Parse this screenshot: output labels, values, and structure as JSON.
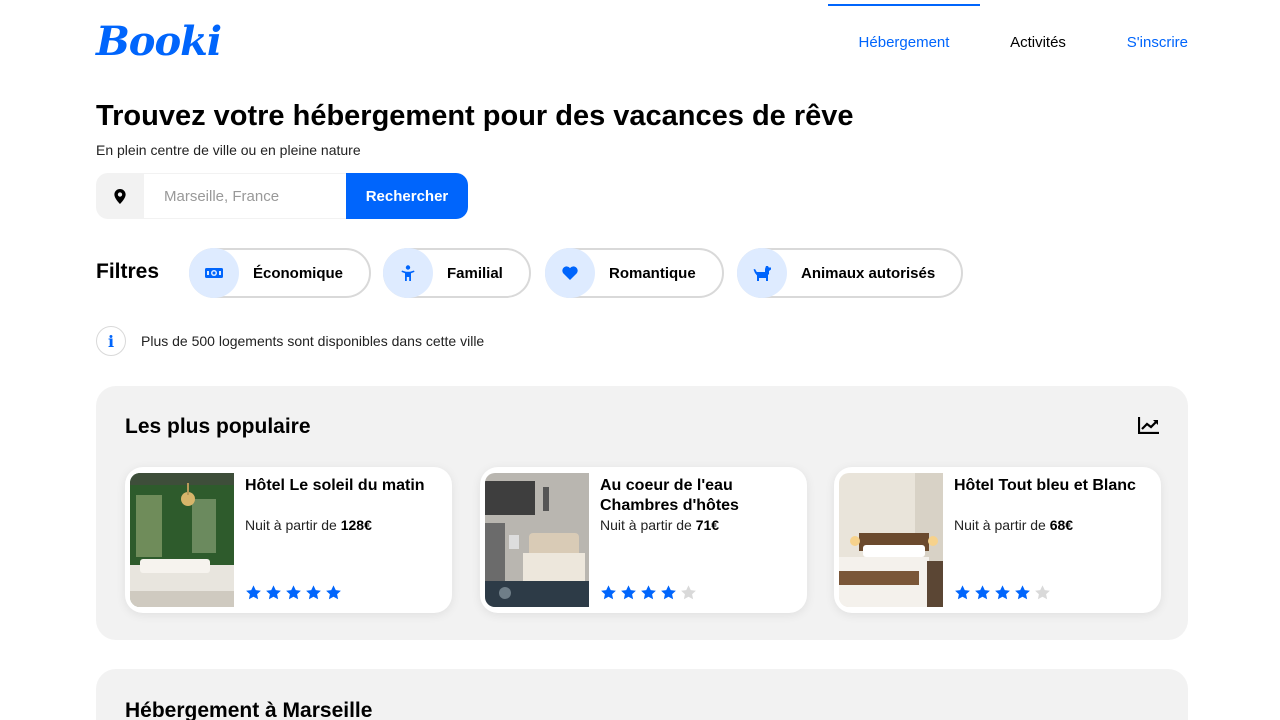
{
  "header": {
    "logo": "Booki",
    "nav": [
      {
        "label": "Hébergement",
        "active": true
      },
      {
        "label": "Activités",
        "active": false
      },
      {
        "label": "S'inscrire",
        "active": false
      }
    ]
  },
  "hero": {
    "title": "Trouvez votre hébergement pour des vacances de rêve",
    "subtitle": "En plein centre de ville ou en pleine nature"
  },
  "search": {
    "icon": "location-pin-icon",
    "placeholder": "Marseille, France",
    "button_label": "Rechercher"
  },
  "filters": {
    "label": "Filtres",
    "items": [
      {
        "label": "Économique",
        "icon": "money-icon"
      },
      {
        "label": "Familial",
        "icon": "child-icon"
      },
      {
        "label": "Romantique",
        "icon": "heart-icon"
      },
      {
        "label": "Animaux autorisés",
        "icon": "dog-icon"
      }
    ]
  },
  "info": {
    "icon": "info-icon",
    "text": "Plus de 500 logements sont disponibles dans cette ville"
  },
  "popular": {
    "title": "Les plus populaire",
    "icon": "trend-chart-icon",
    "price_prefix": "Nuit à partir de",
    "cards": [
      {
        "name": "Hôtel Le soleil du matin",
        "price": "128€",
        "rating": 5,
        "max_rating": 5
      },
      {
        "name": "Au coeur de l'eau Chambres d'hôtes",
        "price": "71€",
        "rating": 4,
        "max_rating": 5
      },
      {
        "name": "Hôtel Tout bleu et Blanc",
        "price": "68€",
        "rating": 4,
        "max_rating": 5
      }
    ]
  },
  "section2": {
    "title": "Hébergement à Marseille"
  },
  "colors": {
    "accent": "#0065FC",
    "accent_light": "#DEEBFF",
    "panel_bg": "#F2F2F2",
    "star_empty": "#D9D9D9"
  }
}
